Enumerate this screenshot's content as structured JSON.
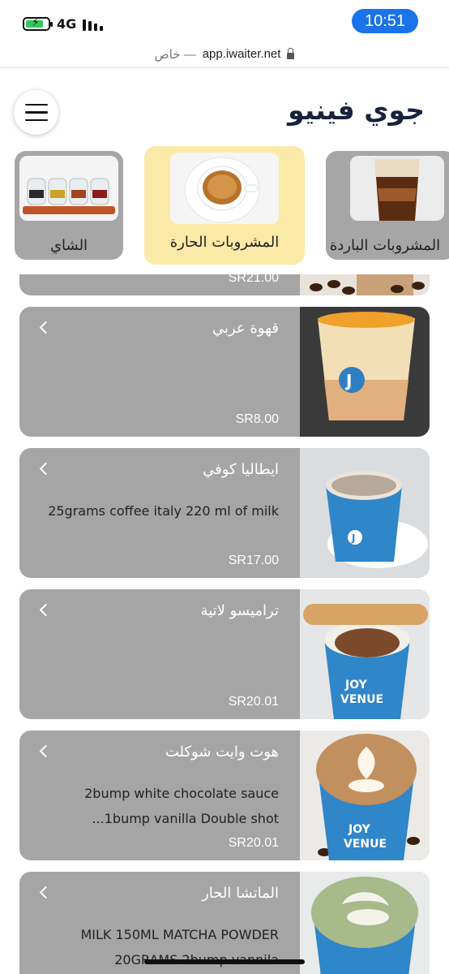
{
  "status_bar": {
    "network": "4G",
    "time": "10:51"
  },
  "browser": {
    "url": "app.iwaiter.net",
    "private_label": "خاص —"
  },
  "header": {
    "restaurant_name": "جوي فينيو",
    "menu_icon": "hamburger-menu-icon"
  },
  "categories": [
    {
      "label": "الشاي",
      "selected": false,
      "image": "tea-drinks-photo"
    },
    {
      "label": "المشروبات الحارة",
      "selected": true,
      "image": "hot-coffee-cup-photo"
    },
    {
      "label": "المشروبات الباردة",
      "selected": false,
      "image": "iced-coffee-photo"
    }
  ],
  "items": [
    {
      "name": "",
      "description": "",
      "price": "SR21.00"
    },
    {
      "name": "قهوة عربي",
      "description": "",
      "price": "SR8.00"
    },
    {
      "name": "ايطاليا كوفي",
      "description": "25grams coffee italy 220 ml of milk",
      "price": "SR17.00"
    },
    {
      "name": "ترامیسو لاتية",
      "description": "",
      "price": "SR20.01"
    },
    {
      "name": "هوت وايت شوكلت",
      "description": "2bump white chocolate sauce 1bump vanilla Double shot...",
      "price": "SR20.01"
    },
    {
      "name": "الماتشا الحار",
      "description": "MILK 150ML MATCHA POWDER 20GRAMS 2bump vannila",
      "price": ""
    }
  ],
  "colors": {
    "accent": "#1a73e8",
    "selected_category": "#fbe9a7",
    "card_background": "#a5a5a5",
    "title": "#17223b"
  }
}
